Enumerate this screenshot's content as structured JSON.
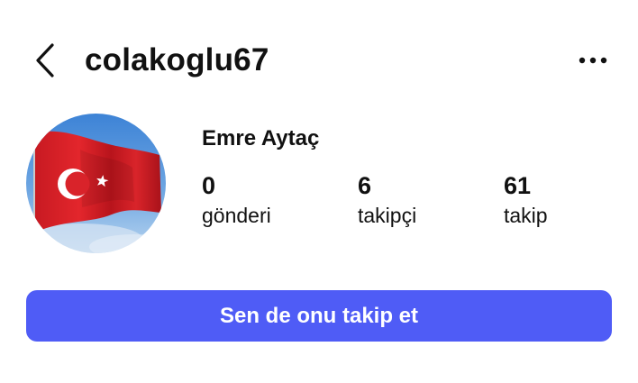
{
  "header": {
    "back_icon": "chevron-left-icon",
    "username": "colakoglu67",
    "more_icon": "more-horizontal-icon"
  },
  "profile": {
    "avatar_description_icon": "turkish-flag-avatar",
    "display_name": "Emre Aytaç",
    "stats": {
      "posts": {
        "value": "0",
        "label": "gönderi"
      },
      "followers": {
        "value": "6",
        "label": "takipçi"
      },
      "following": {
        "value": "61",
        "label": "takip"
      }
    }
  },
  "actions": {
    "follow_back_label": "Sen de onu takip et"
  },
  "colors": {
    "accent": "#4f5cf6",
    "text": "#111111",
    "background": "#ffffff"
  }
}
